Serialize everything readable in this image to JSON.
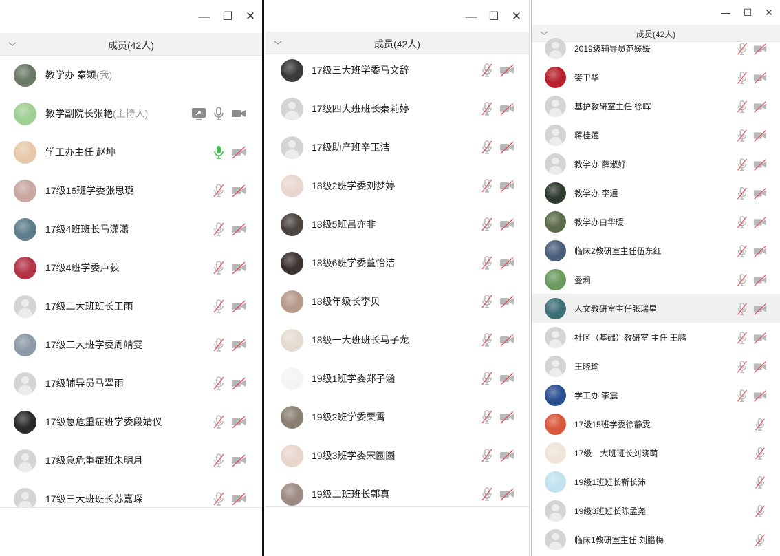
{
  "window": {
    "minimize_glyph": "—",
    "maximize_glyph": "☐",
    "close_glyph": "✕"
  },
  "colors": {
    "muted_icon": "#b9b9b9",
    "muted_slash": "#e0555f",
    "active_mic": "#3cc24f",
    "host_icon": "#8b8b8b",
    "placeholder_avatar": "#d4d4d4"
  },
  "panels": [
    {
      "header": "成员(42人)",
      "members": [
        {
          "name": "教学办  秦颖",
          "tag": "(我)",
          "avatar": "photo",
          "color": "#6b7a66",
          "icons": []
        },
        {
          "name": "教学副院长张艳",
          "tag": "(主持人)",
          "avatar": "photo",
          "color": "#9fcf93",
          "icons": [
            "share-icon",
            "mic-icon",
            "video-icon"
          ]
        },
        {
          "name": "学工办主任  赵坤",
          "tag": "",
          "avatar": "photo",
          "color": "#e7c9a9",
          "icons": [
            "mic-active-icon",
            "video-off-icon"
          ]
        },
        {
          "name": "17级16班学委张思璐",
          "tag": "",
          "avatar": "photo",
          "color": "#c9a6a0",
          "icons": [
            "mic-off-icon",
            "video-off-icon"
          ]
        },
        {
          "name": "17级4班班长马潇潇",
          "tag": "",
          "avatar": "photo",
          "color": "#5e7d8c",
          "icons": [
            "mic-off-icon",
            "video-off-icon"
          ]
        },
        {
          "name": "17级4班学委卢荻",
          "tag": "",
          "avatar": "photo",
          "color": "#b23446",
          "icons": [
            "mic-off-icon",
            "video-off-icon"
          ]
        },
        {
          "name": "17级二大班班长王雨",
          "tag": "",
          "avatar": "default",
          "color": "#d4d4d4",
          "icons": [
            "mic-off-icon",
            "video-off-icon"
          ]
        },
        {
          "name": "17级二大班学委周靖雯",
          "tag": "",
          "avatar": "photo",
          "color": "#8c99a6",
          "icons": [
            "mic-off-icon",
            "video-off-icon"
          ]
        },
        {
          "name": "17级辅导员马翠雨",
          "tag": "",
          "avatar": "default",
          "color": "#d4d4d4",
          "icons": [
            "mic-off-icon",
            "video-off-icon"
          ]
        },
        {
          "name": "17级急危重症班学委段婧仪",
          "tag": "",
          "avatar": "photo",
          "color": "#2b2b2b",
          "icons": [
            "mic-off-icon",
            "video-off-icon"
          ]
        },
        {
          "name": "17级急危重症班朱明月",
          "tag": "",
          "avatar": "default",
          "color": "#d4d4d4",
          "icons": [
            "mic-off-icon",
            "video-off-icon"
          ]
        },
        {
          "name": "17级三大班班长苏嘉琛",
          "tag": "",
          "avatar": "default",
          "color": "#d4d4d4",
          "icons": [
            "mic-off-icon",
            "video-off-icon"
          ]
        }
      ]
    },
    {
      "header": "成员(42人)",
      "members": [
        {
          "name": "17级三大班学委马文辞",
          "tag": "",
          "avatar": "photo",
          "color": "#3a3a3a",
          "icons": [
            "mic-off-icon",
            "video-off-icon"
          ]
        },
        {
          "name": "17级四大班班长秦莉婷",
          "tag": "",
          "avatar": "default",
          "color": "#d4d4d4",
          "icons": [
            "mic-off-icon",
            "video-off-icon"
          ]
        },
        {
          "name": "17级助产班辛玉洁",
          "tag": "",
          "avatar": "default",
          "color": "#d4d4d4",
          "icons": [
            "mic-off-icon",
            "video-off-icon"
          ]
        },
        {
          "name": "18级2班学委刘梦婷",
          "tag": "",
          "avatar": "photo",
          "color": "#e9d7cf",
          "icons": [
            "mic-off-icon",
            "video-off-icon"
          ]
        },
        {
          "name": "18级5班吕亦非",
          "tag": "",
          "avatar": "photo",
          "color": "#4b4440",
          "icons": [
            "mic-off-icon",
            "video-off-icon"
          ]
        },
        {
          "name": "18级6班学委董怡洁",
          "tag": "",
          "avatar": "photo",
          "color": "#3c3230",
          "icons": [
            "mic-off-icon",
            "video-off-icon"
          ]
        },
        {
          "name": "18级年级长李贝",
          "tag": "",
          "avatar": "photo",
          "color": "#b89a8c",
          "icons": [
            "mic-off-icon",
            "video-off-icon"
          ]
        },
        {
          "name": "18级一大班班长马子龙",
          "tag": "",
          "avatar": "photo",
          "color": "#e4dcd2",
          "icons": [
            "mic-off-icon",
            "video-off-icon"
          ]
        },
        {
          "name": "19级1班学委郑子涵",
          "tag": "",
          "avatar": "photo",
          "color": "#f4f4f4",
          "icons": [
            "mic-off-icon",
            "video-off-icon"
          ]
        },
        {
          "name": "19级2班学委栗霄",
          "tag": "",
          "avatar": "photo",
          "color": "#8a8072",
          "icons": [
            "mic-off-icon",
            "video-off-icon"
          ]
        },
        {
          "name": "19级3班学委宋圆圆",
          "tag": "",
          "avatar": "photo",
          "color": "#e8d6cc",
          "icons": [
            "mic-off-icon",
            "video-off-icon"
          ]
        },
        {
          "name": "19级二班班长郭真",
          "tag": "",
          "avatar": "photo",
          "color": "#9d8b83",
          "icons": [
            "mic-off-icon",
            "video-off-icon"
          ]
        }
      ]
    },
    {
      "header": "成员(42人)",
      "members": [
        {
          "name": "2019级辅导员范媛媛",
          "tag": "",
          "avatar": "default",
          "color": "#d4d4d4",
          "icons": [
            "mic-off-icon",
            "video-off-icon"
          ]
        },
        {
          "name": "樊卫华",
          "tag": "",
          "avatar": "photo",
          "color": "#b8202d",
          "icons": [
            "mic-off-icon",
            "video-off-icon"
          ]
        },
        {
          "name": "基护教研室主任 徐晖",
          "tag": "",
          "avatar": "default",
          "color": "#d4d4d4",
          "icons": [
            "mic-off-icon",
            "video-off-icon"
          ]
        },
        {
          "name": "蒋桂莲",
          "tag": "",
          "avatar": "default",
          "color": "#d4d4d4",
          "icons": [
            "mic-off-icon",
            "video-off-icon"
          ]
        },
        {
          "name": "教学办   薛淑好",
          "tag": "",
          "avatar": "default",
          "color": "#d4d4d4",
          "icons": [
            "mic-off-icon",
            "video-off-icon"
          ]
        },
        {
          "name": "教学办 李通",
          "tag": "",
          "avatar": "photo",
          "color": "#2f3a2f",
          "icons": [
            "mic-off-icon",
            "video-off-icon"
          ]
        },
        {
          "name": "教学办白华暖",
          "tag": "",
          "avatar": "photo",
          "color": "#5c6b4a",
          "icons": [
            "mic-off-icon",
            "video-off-icon"
          ]
        },
        {
          "name": "临床2教研室主任伍东红",
          "tag": "",
          "avatar": "photo",
          "color": "#4a5f7a",
          "icons": [
            "mic-off-icon",
            "video-off-icon"
          ]
        },
        {
          "name": "曼莉",
          "tag": "",
          "avatar": "photo",
          "color": "#6a9a5e",
          "icons": [
            "mic-off-icon",
            "video-off-icon"
          ]
        },
        {
          "name": "人文教研室主任张瑞星",
          "tag": "",
          "avatar": "photo",
          "color": "#3d6f77",
          "icons": [
            "mic-off-icon",
            "video-off-icon"
          ],
          "highlight": true
        },
        {
          "name": "社区（基础）教研室  主任  王鹏",
          "tag": "",
          "avatar": "default",
          "color": "#d4d4d4",
          "icons": [
            "mic-off-icon",
            "video-off-icon"
          ]
        },
        {
          "name": "王晓瑜",
          "tag": "",
          "avatar": "default",
          "color": "#d4d4d4",
          "icons": [
            "mic-off-icon",
            "video-off-icon"
          ]
        },
        {
          "name": "学工办 李震",
          "tag": "",
          "avatar": "photo",
          "color": "#2a4f8f",
          "icons": [
            "mic-off-icon",
            "video-off-icon"
          ]
        },
        {
          "name": "17级15班学委徐静雯",
          "tag": "",
          "avatar": "photo",
          "color": "#d9573a",
          "icons": [
            "mic-off-icon"
          ]
        },
        {
          "name": "17级一大班班长刘晓萌",
          "tag": "",
          "avatar": "photo",
          "color": "#efe4d6",
          "icons": [
            "mic-off-icon"
          ]
        },
        {
          "name": "19级1班班长靳长沛",
          "tag": "",
          "avatar": "photo",
          "color": "#bfe2ef",
          "icons": [
            "mic-off-icon"
          ]
        },
        {
          "name": "19级3班班长陈孟尧",
          "tag": "",
          "avatar": "default",
          "color": "#d4d4d4",
          "icons": [
            "mic-off-icon"
          ]
        },
        {
          "name": "临床1教研室主任 刘腊梅",
          "tag": "",
          "avatar": "default",
          "color": "#d4d4d4",
          "icons": [
            "mic-off-icon"
          ]
        }
      ]
    }
  ]
}
